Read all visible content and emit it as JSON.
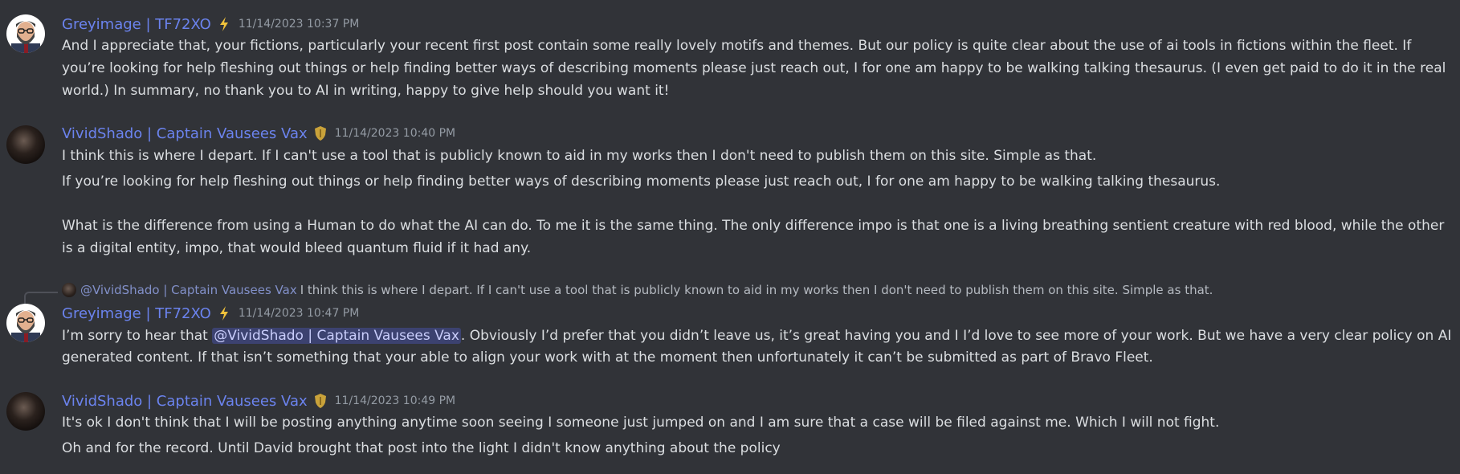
{
  "messages": [
    {
      "author": "Greyimage | TF72XO",
      "badge_icon": "lightning-icon",
      "timestamp": "11/14/2023 10:37 PM",
      "lines": [
        "And I appreciate that, your fictions, particularly your recent first post contain some really lovely motifs and themes. But our policy is quite clear about the use of ai tools in fictions within the fleet. If",
        "you’re looking for help fleshing out things or help finding better ways of describing moments please just reach out, I for one am happy to be walking talking thesaurus. (I even get paid to do it in the real",
        "world.) In summary, no thank you to AI in writing, happy to give help should you want it!"
      ]
    },
    {
      "author": "VividShado | Captain Vausees Vax",
      "badge_icon": "shield-icon",
      "timestamp": "11/14/2023 10:40 PM",
      "lines": [
        "I think this is where I depart. If I can't use a tool that is publicly known to aid in my works then I don't need to publish them on this site. Simple as that.",
        "If you’re looking for help fleshing out things or help finding better ways of describing moments please just reach out, I for one am happy to be walking talking thesaurus.",
        "What is the difference from using a Human to do what the AI can do. To me it is the same thing. The only difference impo is that one is a living breathing sentient creature with red blood, while the other",
        "is a digital entity, impo, that would bleed quantum fluid if it had any."
      ]
    },
    {
      "reply": {
        "author": "@VividShado | Captain Vausees Vax",
        "text": "I think this is where I depart. If I can't use a tool that is publicly known to aid in my works then I don't need to publish them on this site. Simple as that."
      },
      "author": "Greyimage | TF72XO",
      "badge_icon": "lightning-icon",
      "timestamp": "11/14/2023 10:47 PM",
      "line1_before": "I’m sorry to hear that ",
      "mention": "@VividShado | Captain Vausees Vax",
      "line1_after": ". Obviously I’d prefer that you didn’t leave us, it’s great having you and I I’d love to see more of your work. But we have a very clear policy on AI",
      "line2": "generated content. If that isn’t something that your able to align your work with at the moment then unfortunately it can’t be submitted as part of Bravo Fleet."
    },
    {
      "author": "VividShado | Captain Vausees Vax",
      "badge_icon": "shield-icon",
      "timestamp": "11/14/2023 10:49 PM",
      "lines": [
        "It's ok I don't think that I will be posting anything anytime soon seeing I someone just jumped on and I am sure that a case will be filed against me. Which I will not fight.",
        "Oh and for the record. Until David brought that post into the light I didn't know anything about the policy"
      ]
    }
  ],
  "colors": {
    "background": "#313338",
    "username": "#6b83ee",
    "text": "#dbdee1",
    "timestamp": "#949ba4",
    "mention_bg": "#3c4270"
  }
}
